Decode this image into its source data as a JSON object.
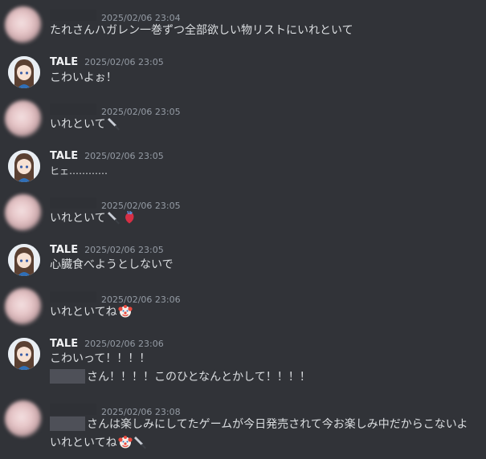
{
  "messages": [
    {
      "avatar": "blurred",
      "username": "",
      "time": "2025/02/06 23:04",
      "lines": [
        "たれさんハガレン一巻ずつ全部欲しい物リストにいれといて"
      ]
    },
    {
      "avatar": "tale",
      "username": "TALE",
      "time": "2025/02/06 23:05",
      "lines": [
        "こわいよぉ！"
      ]
    },
    {
      "avatar": "blurred",
      "username": "",
      "time": "2025/02/06 23:05",
      "lines": [
        "いれといて"
      ],
      "emoji": [
        "knife"
      ]
    },
    {
      "avatar": "tale",
      "username": "TALE",
      "time": "2025/02/06 23:05",
      "lines": [
        "ヒェ…………"
      ]
    },
    {
      "avatar": "blurred",
      "username": "",
      "time": "2025/02/06 23:05",
      "lines": [
        "いれといて"
      ],
      "emoji": [
        "knife",
        "anatomical-heart"
      ]
    },
    {
      "avatar": "tale",
      "username": "TALE",
      "time": "2025/02/06 23:05",
      "lines": [
        "心臓食べようとしないで"
      ]
    },
    {
      "avatar": "blurred",
      "username": "",
      "time": "2025/02/06 23:06",
      "lines": [
        "いれといてね"
      ],
      "emoji": [
        "clown"
      ]
    },
    {
      "avatar": "tale",
      "username": "TALE",
      "time": "2025/02/06 23:06",
      "lines": [
        "こわいって！！！！",
        "さん！！！！このひとなんとかして！！！！"
      ]
    },
    {
      "avatar": "blurred",
      "username": "",
      "time": "2025/02/06 23:08",
      "lines": [
        "さんは楽しみにしてたゲームが今日発売されて今お楽しみ中だからこないよ",
        "いれといてね"
      ],
      "emoji": [
        "clown",
        "knife"
      ]
    }
  ]
}
